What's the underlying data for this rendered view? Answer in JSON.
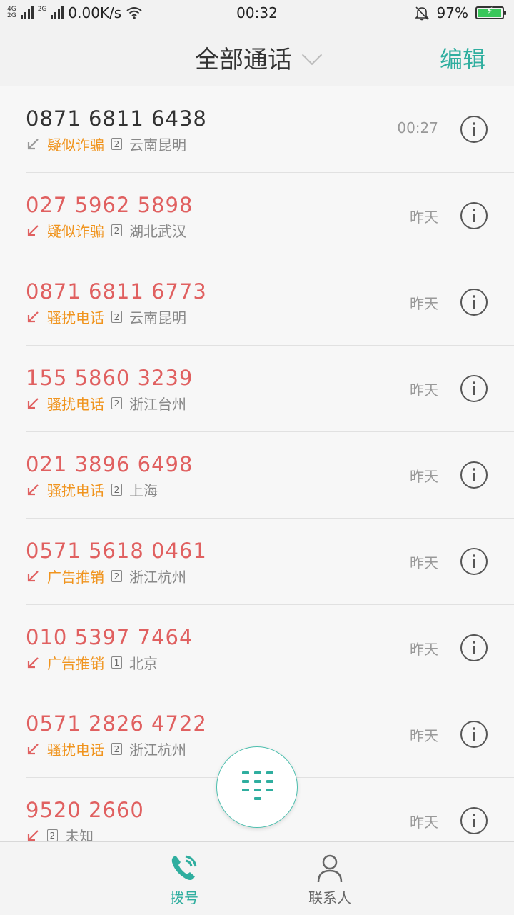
{
  "status_bar": {
    "network1": "4G",
    "network2": "2G",
    "speed": "0.00K/s",
    "time": "00:32",
    "battery": "97%",
    "battery_fraction": 0.97
  },
  "header": {
    "title": "全部通话",
    "edit_label": "编辑"
  },
  "calls": [
    {
      "number": "0871 6811 6438",
      "tag": "疑似诈骗",
      "sim": "2",
      "location": "云南昆明",
      "time": "00:27",
      "missed": false
    },
    {
      "number": "027 5962 5898",
      "tag": "疑似诈骗",
      "sim": "2",
      "location": "湖北武汉",
      "time": "昨天",
      "missed": true
    },
    {
      "number": "0871 6811 6773",
      "tag": "骚扰电话",
      "sim": "2",
      "location": "云南昆明",
      "time": "昨天",
      "missed": true
    },
    {
      "number": "155 5860 3239",
      "tag": "骚扰电话",
      "sim": "2",
      "location": "浙江台州",
      "time": "昨天",
      "missed": true
    },
    {
      "number": "021 3896 6498",
      "tag": "骚扰电话",
      "sim": "2",
      "location": "上海",
      "time": "昨天",
      "missed": true
    },
    {
      "number": "0571 5618 0461",
      "tag": "广告推销",
      "sim": "2",
      "location": "浙江杭州",
      "time": "昨天",
      "missed": true
    },
    {
      "number": "010 5397 7464",
      "tag": "广告推销",
      "sim": "1",
      "location": "北京",
      "time": "昨天",
      "missed": true
    },
    {
      "number": "0571 2826 4722",
      "tag": "骚扰电话",
      "sim": "2",
      "location": "浙江杭州",
      "time": "昨天",
      "missed": true
    },
    {
      "number": "9520 2660",
      "tag": "",
      "sim": "2",
      "location": "未知",
      "time": "昨天",
      "missed": true
    }
  ],
  "bottom_nav": {
    "dial_label": "拨号",
    "contacts_label": "联系人"
  },
  "colors": {
    "accent": "#2fae9f",
    "missed_number": "#e06060",
    "tag": "#f0941e",
    "missed_arrow": "#e06060",
    "normal_arrow": "#999999"
  }
}
